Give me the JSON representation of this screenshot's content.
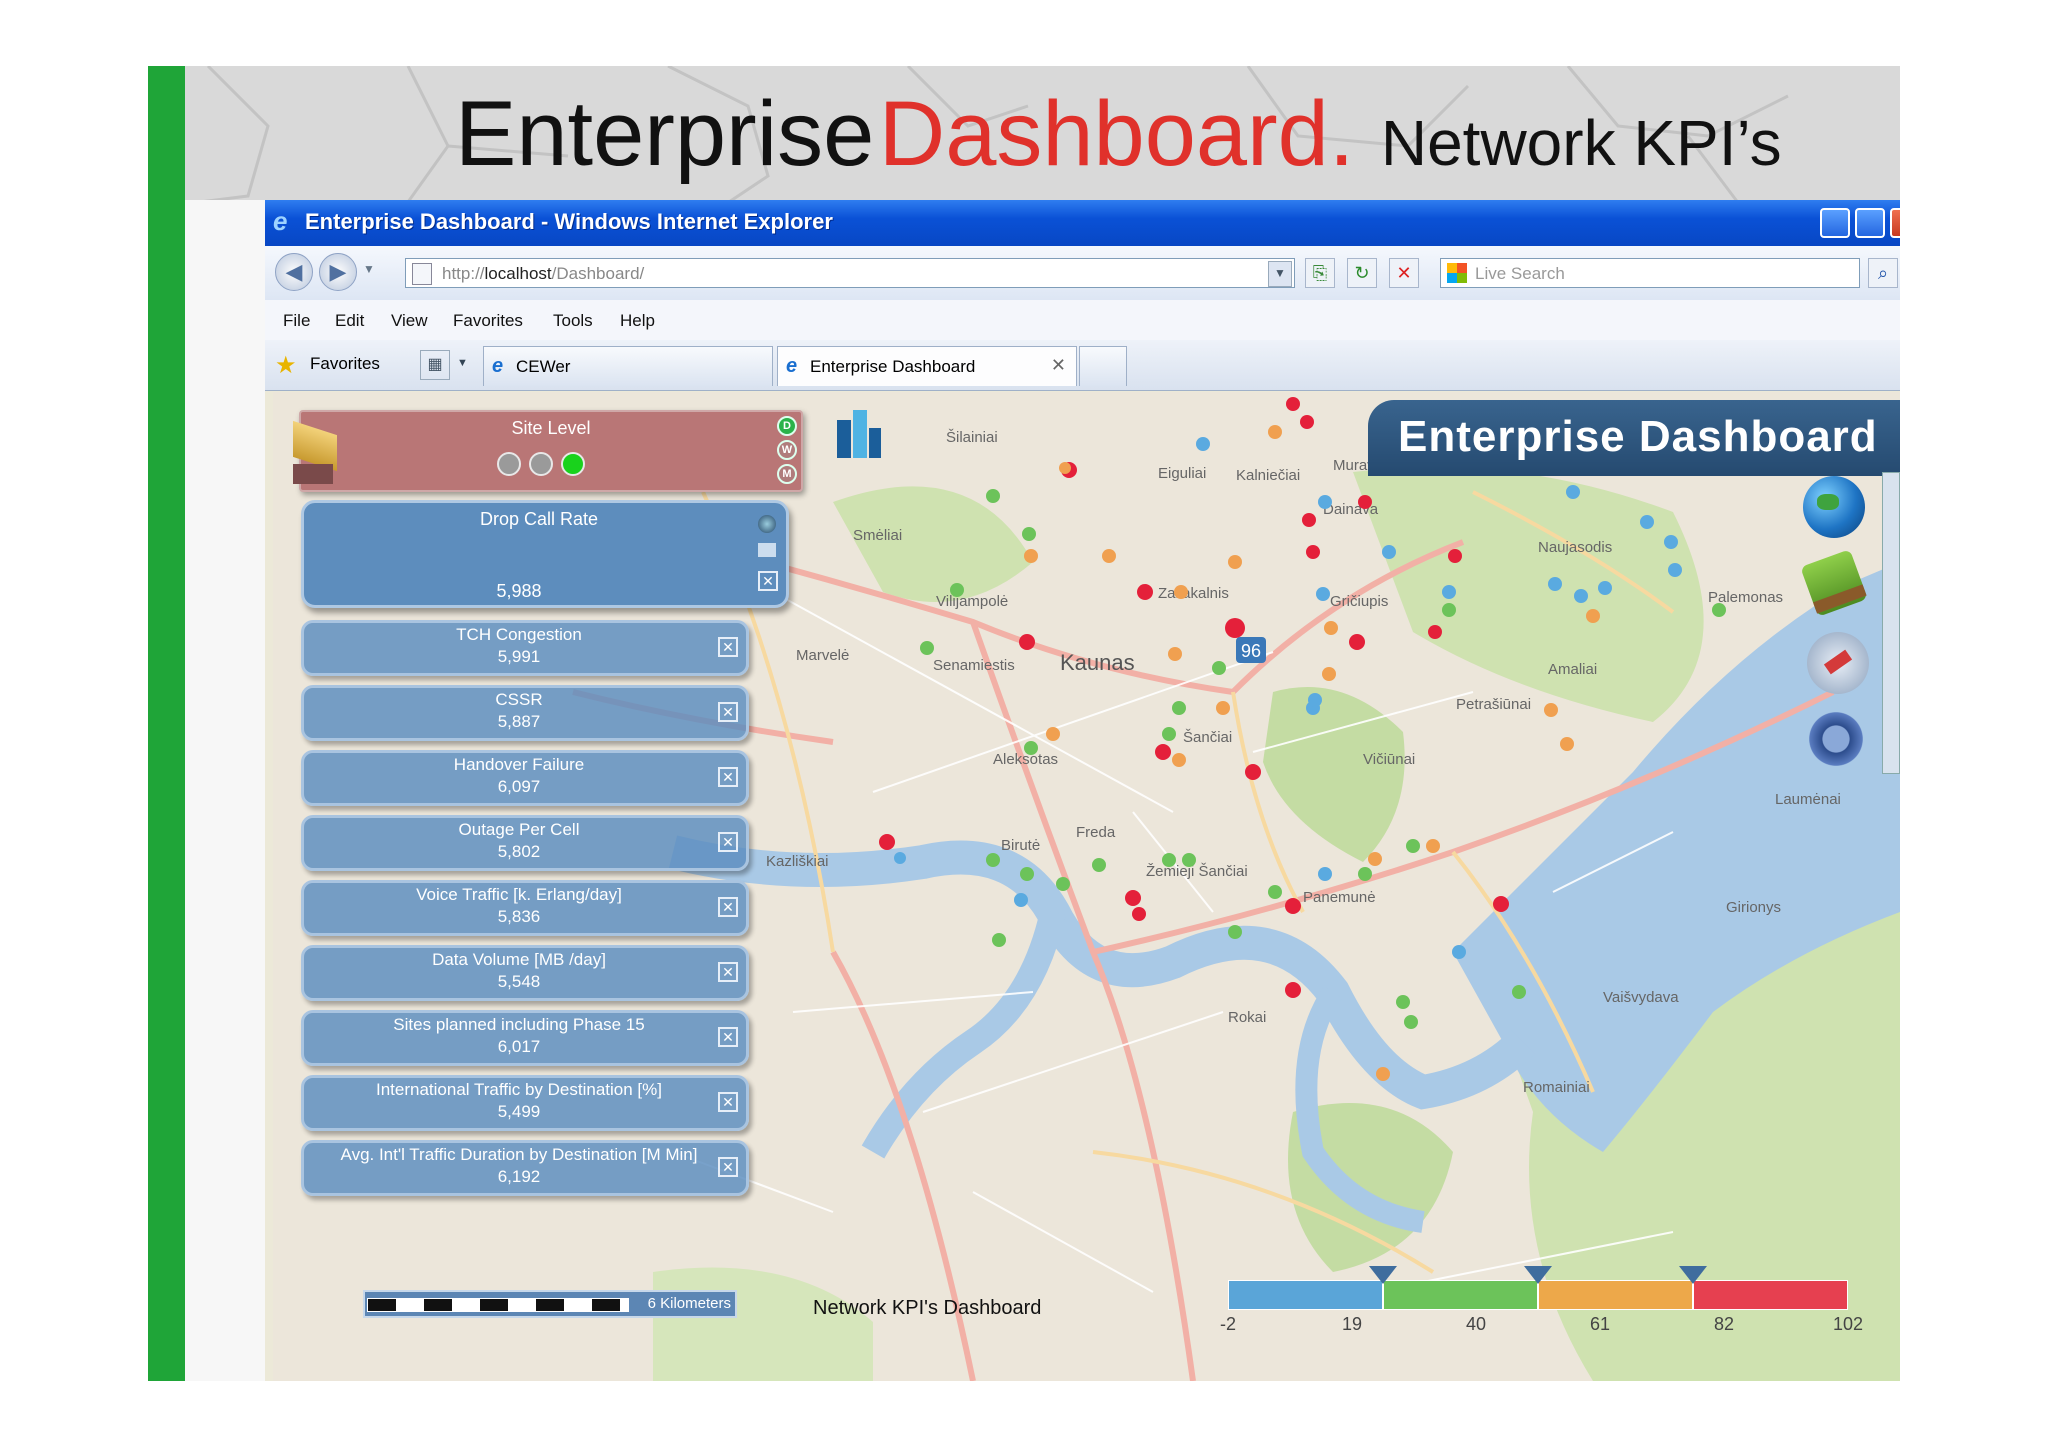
{
  "slide": {
    "title_part1": "Enterprise",
    "title_part2": "Dashboard.",
    "title_part3": "Network KPI’s"
  },
  "browser": {
    "window_title": "Enterprise Dashboard - Windows Internet Explorer",
    "url_prefix": "http://",
    "url_host": "localhost",
    "url_path": "/Dashboard/",
    "search_placeholder": "Live Search",
    "menu": [
      "File",
      "Edit",
      "View",
      "Favorites",
      "Tools",
      "Help"
    ],
    "favorites_label": "Favorites",
    "tabs": [
      {
        "label": "CEWer",
        "active": false
      },
      {
        "label": "Enterprise Dashboard",
        "active": true
      }
    ]
  },
  "dashboard": {
    "banner_title": "Enterprise Dashboard",
    "site_level": {
      "label": "Site Level",
      "side_buttons": [
        "D",
        "W",
        "M"
      ],
      "indicator_colors": [
        "#9a9a9a",
        "#9a9a9a",
        "#19d21c"
      ]
    },
    "kpis": [
      {
        "name": "Drop Call Rate",
        "value": "5,988"
      },
      {
        "name": "TCH Congestion",
        "value": "5,991"
      },
      {
        "name": "CSSR",
        "value": "5,887"
      },
      {
        "name": "Handover Failure",
        "value": "6,097"
      },
      {
        "name": "Outage Per Cell",
        "value": "5,802"
      },
      {
        "name": "Voice Traffic  [k. Erlang/day]",
        "value": "5,836"
      },
      {
        "name": "Data Volume  [MB /day]",
        "value": "5,548"
      },
      {
        "name": "Sites planned including Phase 15",
        "value": "6,017"
      },
      {
        "name": "International Traffic by Destination [%]",
        "value": "5,499"
      },
      {
        "name": "Avg. Int'l Traffic Duration by Destination [M Min]",
        "value": "6,192"
      }
    ],
    "scale_label": "6 Kilometers",
    "footer_title": "Network KPI's Dashboard",
    "legend": {
      "ticks": [
        "-2",
        "19",
        "40",
        "61",
        "82",
        "102"
      ],
      "colors": [
        "#5aa5d8",
        "#6cc35a",
        "#eda84a",
        "#e64050"
      ],
      "marker_color": "#3f6d9e"
    },
    "map_labels": [
      {
        "text": "Kaunas"
      },
      {
        "text": "Naujasodis"
      },
      {
        "text": "Zaliakalnis"
      },
      {
        "text": "Vilijampolė"
      },
      {
        "text": "Šančiai"
      },
      {
        "text": "Aleksotas"
      },
      {
        "text": "Freda"
      },
      {
        "text": "Petrašiūnai"
      },
      {
        "text": "Panemunė"
      },
      {
        "text": "Eiguliai"
      },
      {
        "text": "Dainava"
      },
      {
        "text": "Gričiupis"
      },
      {
        "text": "Amaliai"
      },
      {
        "text": "Palemonas"
      },
      {
        "text": "Vičiūnai"
      },
      {
        "text": "Šilainiai"
      },
      {
        "text": "Smėliai"
      },
      {
        "text": "Kalniečiai"
      },
      {
        "text": "Muravа"
      },
      {
        "text": "Laumėnai"
      },
      {
        "text": "Girionys"
      },
      {
        "text": "Rokai"
      },
      {
        "text": "Žemieji Šančiai"
      },
      {
        "text": "Birutė"
      },
      {
        "text": "Romainiai"
      },
      {
        "text": "Marvelė"
      },
      {
        "text": "Senamiestis"
      },
      {
        "text": "Kazliškiai"
      },
      {
        "text": "Vaišvydava"
      }
    ],
    "road_badge": "96"
  }
}
